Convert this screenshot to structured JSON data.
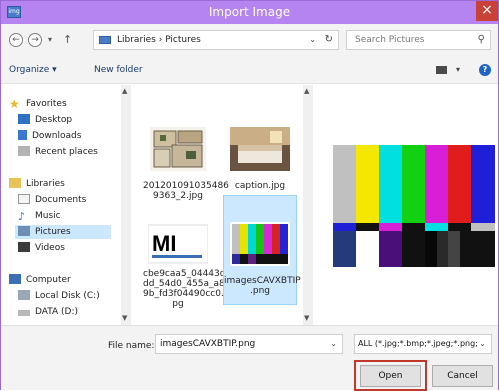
{
  "window": {
    "title": "Import Image",
    "close_label": "×",
    "accent": "#b584f0"
  },
  "address": {
    "crumbs": "Libraries  ›  Pictures",
    "search_placeholder": "Search Pictures"
  },
  "toolbar": {
    "organize": "Organize ▾",
    "new_folder": "New folder"
  },
  "nav": {
    "favorites": "Favorites",
    "desktop": "Desktop",
    "downloads": "Downloads",
    "recent": "Recent places",
    "libraries": "Libraries",
    "documents": "Documents",
    "music": "Music",
    "pictures": "Pictures",
    "videos": "Videos",
    "computer": "Computer",
    "local_disk": "Local Disk (C:)",
    "data_disk": "DATA (D:)"
  },
  "files": [
    {
      "name_line1": "201201091035486",
      "name_line2": "9363_2.jpg"
    },
    {
      "name_line1": "caption.jpg"
    },
    {
      "name_line1": "cbe9caa5_04443d",
      "name_line2": "dd_54d0_455a_a8",
      "name_line3": "9b_fd3f04490cc0.j",
      "name_line4": "pg"
    },
    {
      "name_line1": "imagesCAVXBTIP",
      "name_line2": ".png"
    }
  ],
  "footer": {
    "file_name_label": "File name:",
    "file_name_value": "imagesCAVXBTIP.png",
    "filter_value": "ALL (*.jpg;*.bmp;*.jpeg;*.png;*.",
    "open": "Open",
    "cancel": "Cancel"
  }
}
